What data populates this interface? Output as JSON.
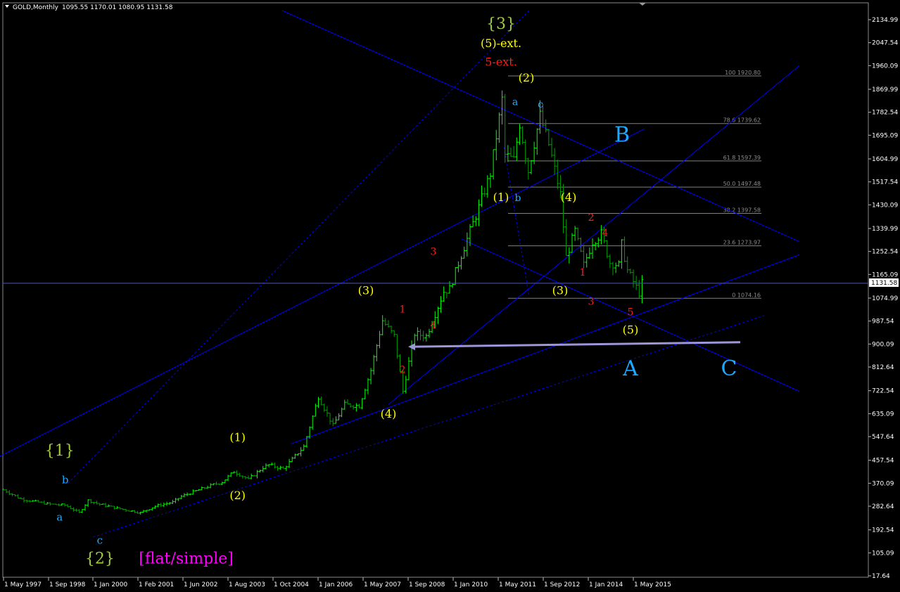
{
  "header": {
    "title": "GOLD,Monthly",
    "ohlc": "1095.55 1170.01 1080.95 1131.58",
    "arrow_icon": "triangle-down-icon"
  },
  "colors": {
    "background": "#000000",
    "bull_bar": "#00ff00",
    "bear_bar": "#00a000",
    "channel_line": "#0000ff",
    "fib_line": "#808080",
    "current_price_line": "#4a5aa8",
    "arrow": "#9d96d9",
    "label_yellow": "#ffff00",
    "label_cyan": "#1fa8ff",
    "label_green": "#9fcc3c",
    "label_red": "#ff1c1c",
    "label_magenta": "#ff00ff"
  },
  "current_price": "1131.58",
  "chart_data": {
    "type": "ohlc-bar",
    "instrument": "GOLD",
    "timeframe": "Monthly",
    "ohlc_last": {
      "open": 1095.55,
      "high": 1170.01,
      "low": 1080.95,
      "close": 1131.58
    },
    "ylim": [
      17.64,
      2170
    ],
    "price_ticks": [
      "2134.99",
      "2047.54",
      "1960.09",
      "1869.99",
      "1782.54",
      "1695.09",
      "1604.99",
      "1517.54",
      "1430.09",
      "1339.99",
      "1252.54",
      "1165.09",
      "1074.99",
      "987.54",
      "900.09",
      "812.64",
      "722.54",
      "635.09",
      "547.64",
      "457.54",
      "370.09",
      "282.64",
      "192.54",
      "105.09",
      "17.64"
    ],
    "date_ticks": [
      "1 May 1997",
      "1 Sep 1998",
      "1 Jan 2000",
      "1 Feb 2001",
      "1 Jun 2002",
      "1 Aug 2003",
      "1 Oct 2004",
      "1 Jan 2006",
      "1 May 2007",
      "1 Sep 2008",
      "1 Jan 2010",
      "1 May 2011",
      "1 Sep 2012",
      "1 Jan 2014",
      "1 May 2015"
    ],
    "fibonacci": [
      {
        "label": "100 1920.80",
        "price": 1920.8
      },
      {
        "label": "78.6 1739.62",
        "price": 1739.62
      },
      {
        "label": "61.8 1597.39",
        "price": 1597.39
      },
      {
        "label": "50.0 1497.48",
        "price": 1497.48
      },
      {
        "label": "38.2 1397.58",
        "price": 1397.58
      },
      {
        "label": "23.6 1273.97",
        "price": 1273.97
      },
      {
        "label": "0 1074.16",
        "price": 1074.16
      }
    ],
    "close_path": [
      [
        "1997-05",
        345
      ],
      [
        "1997-11",
        310
      ],
      [
        "1998-05",
        298
      ],
      [
        "1998-09",
        290
      ],
      [
        "1999-02",
        287
      ],
      [
        "1999-07",
        258
      ],
      [
        "1999-10",
        305
      ],
      [
        "2000-02",
        290
      ],
      [
        "2000-08",
        275
      ],
      [
        "2001-02",
        262
      ],
      [
        "2001-04",
        258
      ],
      [
        "2001-09",
        283
      ],
      [
        "2002-03",
        298
      ],
      [
        "2002-06",
        320
      ],
      [
        "2002-12",
        345
      ],
      [
        "2003-05",
        365
      ],
      [
        "2003-08",
        375
      ],
      [
        "2003-12",
        415
      ],
      [
        "2004-05",
        385
      ],
      [
        "2004-10",
        430
      ],
      [
        "2004-12",
        440
      ],
      [
        "2005-05",
        425
      ],
      [
        "2005-12",
        510
      ],
      [
        "2006-05",
        700
      ],
      [
        "2006-10",
        590
      ],
      [
        "2007-02",
        670
      ],
      [
        "2007-07",
        665
      ],
      [
        "2007-11",
        800
      ],
      [
        "2008-03",
        990
      ],
      [
        "2008-07",
        930
      ],
      [
        "2008-10",
        720
      ],
      [
        "2009-02",
        940
      ],
      [
        "2009-06",
        930
      ],
      [
        "2009-12",
        1100
      ],
      [
        "2010-02",
        1110
      ],
      [
        "2010-06",
        1240
      ],
      [
        "2010-12",
        1420
      ],
      [
        "2011-04",
        1550
      ],
      [
        "2011-08",
        1830
      ],
      [
        "2011-09",
        1620
      ],
      [
        "2011-12",
        1600
      ],
      [
        "2012-02",
        1740
      ],
      [
        "2012-05",
        1560
      ],
      [
        "2012-09",
        1770
      ],
      [
        "2012-12",
        1660
      ],
      [
        "2013-04",
        1470
      ],
      [
        "2013-06",
        1230
      ],
      [
        "2013-09",
        1330
      ],
      [
        "2013-12",
        1200
      ],
      [
        "2014-03",
        1290
      ],
      [
        "2014-06",
        1320
      ],
      [
        "2014-09",
        1210
      ],
      [
        "2014-12",
        1200
      ],
      [
        "2015-01",
        1280
      ],
      [
        "2015-03",
        1180
      ],
      [
        "2015-07",
        1095
      ],
      [
        "2015-08",
        1131.58
      ]
    ]
  },
  "wave_labels": [
    {
      "text": "{1}",
      "color": "green",
      "date": "1999-01",
      "price": 475,
      "size": 22
    },
    {
      "text": "b",
      "color": "cyan",
      "date": "1999-03",
      "price": 370,
      "size": 15
    },
    {
      "text": "a",
      "color": "cyan",
      "date": "1999-01",
      "price": 228,
      "size": 15
    },
    {
      "text": "c",
      "color": "cyan",
      "date": "2000-03",
      "price": 140,
      "size": 15
    },
    {
      "text": "{2}",
      "color": "green",
      "date": "2000-03",
      "price": 65,
      "size": 22
    },
    {
      "text": "[flat/simple]",
      "color": "magenta",
      "date": "2002-07",
      "price": 65,
      "size": 22
    },
    {
      "text": "(1)",
      "color": "yellow",
      "date": "2003-11",
      "price": 530,
      "size": 16
    },
    {
      "text": "(2)",
      "color": "yellow",
      "date": "2003-11",
      "price": 310,
      "size": 16
    },
    {
      "text": "(3)",
      "color": "yellow",
      "date": "2007-06",
      "price": 1090,
      "size": 16
    },
    {
      "text": "(4)",
      "color": "yellow",
      "date": "2008-02",
      "price": 620,
      "size": 16
    },
    {
      "text": "1",
      "color": "red",
      "date": "2008-07",
      "price": 1020,
      "size": 14
    },
    {
      "text": "2",
      "color": "red",
      "date": "2008-07",
      "price": 790,
      "size": 14
    },
    {
      "text": "3",
      "color": "red",
      "date": "2009-06",
      "price": 1240,
      "size": 14
    },
    {
      "text": "4",
      "color": "red",
      "date": "2009-06",
      "price": 960,
      "size": 14
    },
    {
      "text": "{3}",
      "color": "green",
      "date": "2011-06",
      "price": 2100,
      "size": 22
    },
    {
      "text": "(5)-ext.",
      "color": "yellow",
      "date": "2011-06",
      "price": 2030,
      "size": 16
    },
    {
      "text": "5-ext.",
      "color": "red",
      "date": "2011-06",
      "price": 1960,
      "size": 16
    },
    {
      "text": "(2)",
      "color": "yellow",
      "date": "2012-03",
      "price": 1900,
      "size": 16
    },
    {
      "text": "a",
      "color": "cyan",
      "date": "2011-11",
      "price": 1810,
      "size": 14
    },
    {
      "text": "c",
      "color": "cyan",
      "date": "2012-08",
      "price": 1800,
      "size": 14
    },
    {
      "text": "(1)",
      "color": "yellow",
      "date": "2011-06",
      "price": 1445,
      "size": 16
    },
    {
      "text": "b",
      "color": "cyan",
      "date": "2011-12",
      "price": 1445,
      "size": 14
    },
    {
      "text": "B",
      "color": "cyan",
      "date": "2015-01",
      "price": 1670,
      "size": 30
    },
    {
      "text": "(4)",
      "color": "yellow",
      "date": "2013-06",
      "price": 1445,
      "size": 16
    },
    {
      "text": "2",
      "color": "red",
      "date": "2014-02",
      "price": 1370,
      "size": 14
    },
    {
      "text": "4",
      "color": "red",
      "date": "2014-07",
      "price": 1310,
      "size": 14
    },
    {
      "text": "1",
      "color": "red",
      "date": "2013-11",
      "price": 1160,
      "size": 14
    },
    {
      "text": "(3)",
      "color": "yellow",
      "date": "2013-03",
      "price": 1090,
      "size": 16
    },
    {
      "text": "3",
      "color": "red",
      "date": "2014-02",
      "price": 1050,
      "size": 14
    },
    {
      "text": "5",
      "color": "red",
      "date": "2015-04",
      "price": 1010,
      "size": 14
    },
    {
      "text": "(5)",
      "color": "yellow",
      "date": "2015-04",
      "price": 940,
      "size": 16
    },
    {
      "text": "A",
      "color": "cyan",
      "date": "2015-04",
      "price": 780,
      "size": 30
    },
    {
      "text": "C",
      "color": "cyan",
      "date": "2018-03",
      "price": 780,
      "size": 30
    }
  ],
  "trendlines": [
    {
      "name": "upper-left-channel",
      "p1": [
        "1996-11",
        447
      ],
      "p2": [
        "2015-09",
        1720
      ],
      "style": "solid",
      "color": "blue"
    },
    {
      "name": "lower-support-line",
      "p1": [
        "2005-04",
        520
      ],
      "p2": [
        "2020-04",
        1240
      ],
      "style": "solid",
      "color": "blue"
    },
    {
      "name": "wave4-steep-channel",
      "p1": [
        "2008-02",
        670
      ],
      "p2": [
        "2020-04",
        1960
      ],
      "style": "solid",
      "color": "blue"
    },
    {
      "name": "upper-descending-channel",
      "p1": [
        "2005-01",
        2170
      ],
      "p2": [
        "2020-04",
        1290
      ],
      "style": "solid",
      "color": "blue"
    },
    {
      "name": "lower-descending-channel",
      "p1": [
        "2010-04",
        1300
      ],
      "p2": [
        "2020-04",
        720
      ],
      "style": "solid",
      "color": "blue"
    },
    {
      "name": "steep-dotted-line",
      "p1": [
        "1999-04",
        370
      ],
      "p2": [
        "2012-04",
        2170
      ],
      "style": "dotted",
      "color": "blue"
    },
    {
      "name": "base-dotted-line",
      "p1": [
        "2000-01",
        165
      ],
      "p2": [
        "2019-04",
        1010
      ],
      "style": "dotted",
      "color": "blue"
    },
    {
      "name": "wave-b-dotted",
      "p1": [
        "2011-07",
        1650
      ],
      "p2": [
        "2012-04",
        1080
      ],
      "style": "dotted",
      "color": "blue"
    }
  ],
  "arrow": {
    "from": [
      "2018-07",
      907
    ],
    "to": [
      "2008-09",
      890
    ]
  }
}
